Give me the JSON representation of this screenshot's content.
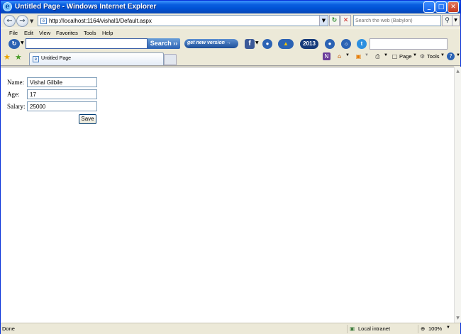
{
  "window": {
    "title": "Untitled Page - Windows Internet Explorer"
  },
  "address_bar": {
    "url": "http://localhost:1164/vishal1/Default.aspx"
  },
  "search_box": {
    "placeholder": "Search the web (Babylon)"
  },
  "menu": {
    "items": [
      "File",
      "Edit",
      "View",
      "Favorites",
      "Tools",
      "Help"
    ]
  },
  "toolbar": {
    "search_label": "Search ››",
    "new_version_label": "get new version →",
    "badge_2013": "2013"
  },
  "tab": {
    "label": "Untitled Page"
  },
  "commands": {
    "page_label": "Page",
    "tools_label": "Tools"
  },
  "form": {
    "name_label": "Name:",
    "name_value": "Vishal Gilbile",
    "age_label": "Age:",
    "age_value": "17",
    "salary_label": "Salary:",
    "salary_value": "25000",
    "save_label": "Save"
  },
  "status_bar": {
    "status": "Done",
    "zone": "Local intranet",
    "zoom": "100%"
  },
  "colors": {
    "title_bar": "#0a5fe0",
    "accent": "#2c63b4"
  }
}
